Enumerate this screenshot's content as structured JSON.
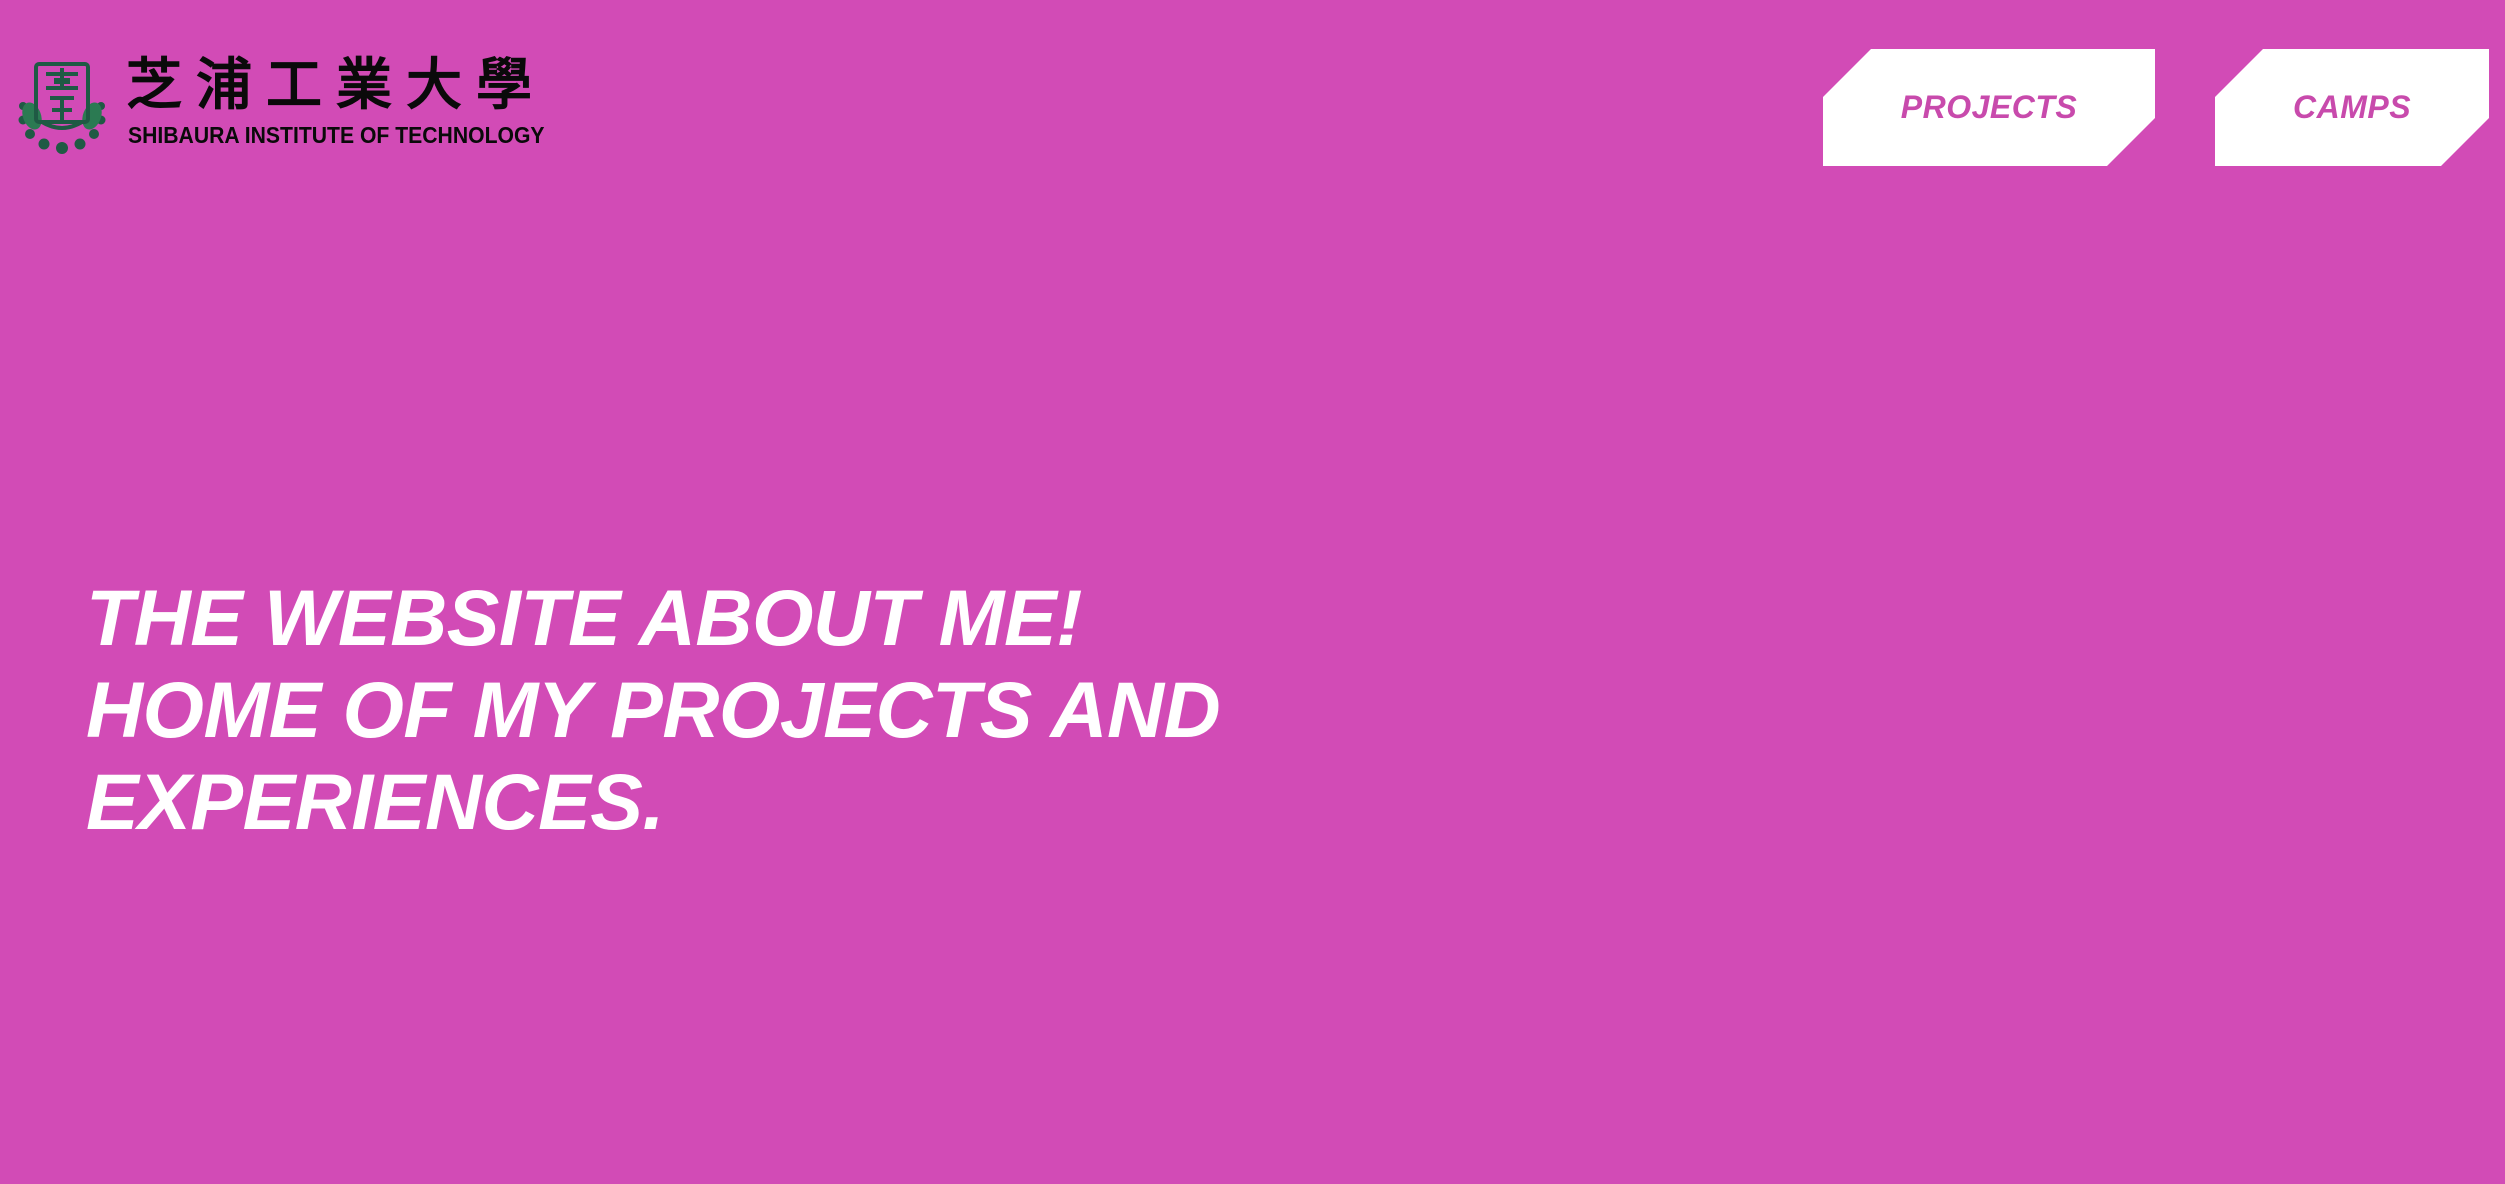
{
  "logo": {
    "kanji": "芝浦工業大學",
    "english": "SHIBAURA INSTITUTE OF TECHNOLOGY",
    "seal_icon": "university-seal-icon",
    "seal_color": "#1f5a44"
  },
  "nav": {
    "projects_label": "PROJECTS",
    "camps_label": "CAMPS"
  },
  "hero": {
    "line1": "THE WEBSITE ABOUT ME!",
    "line2": "HOME OF MY PROJECTS AND",
    "line3": "EXPERIENCES."
  },
  "colors": {
    "background": "#d24bb6",
    "button_bg": "#ffffff",
    "button_text": "#c84aac",
    "hero_text": "#ffffff"
  }
}
